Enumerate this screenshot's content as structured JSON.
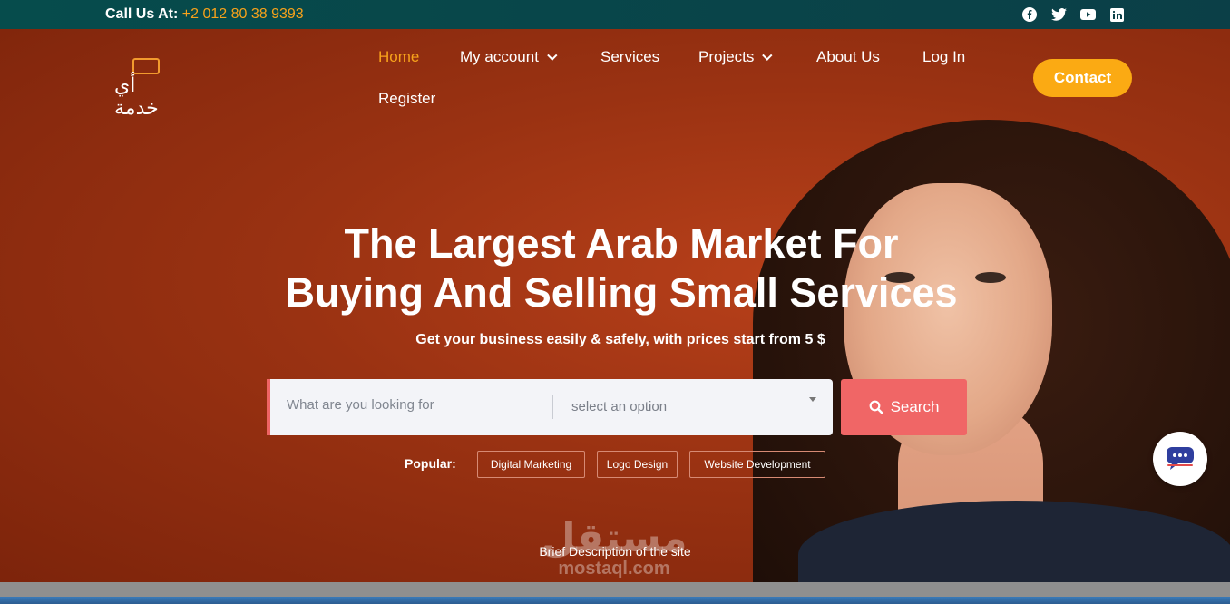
{
  "topbar": {
    "call_label": "Call Us At:",
    "phone": "+2 012 80 38 9393",
    "socials": [
      "facebook-icon",
      "twitter-icon",
      "youtube-icon",
      "linkedin-icon"
    ]
  },
  "header": {
    "logo_text": "أي خدمة",
    "nav": {
      "home": "Home",
      "my_account": "My account",
      "services": "Services",
      "projects": "Projects",
      "about": "About Us",
      "login": "Log In",
      "register": "Register"
    },
    "contact_label": "Contact"
  },
  "hero": {
    "title_line1": "The Largest Arab Market For",
    "title_line2": "Buying And Selling Small Services",
    "subtitle": "Get your business easily & safely, with prices start from 5 $",
    "search_placeholder": "What are you looking for",
    "select_placeholder": "select an option",
    "search_button": "Search",
    "popular_label": "Popular:",
    "tags": [
      "Digital Marketing",
      "Logo Design",
      "Website Development"
    ],
    "brief": "Brief Description of the site"
  },
  "watermark": {
    "arabic": "مستقل",
    "latin": "mostaql.com"
  },
  "colors": {
    "accent": "#f7a21b",
    "contact_button": "#fbaa13",
    "search_button": "#f06666",
    "hero_bg": "#9a3212",
    "topbar_bg": "#064c4c"
  }
}
